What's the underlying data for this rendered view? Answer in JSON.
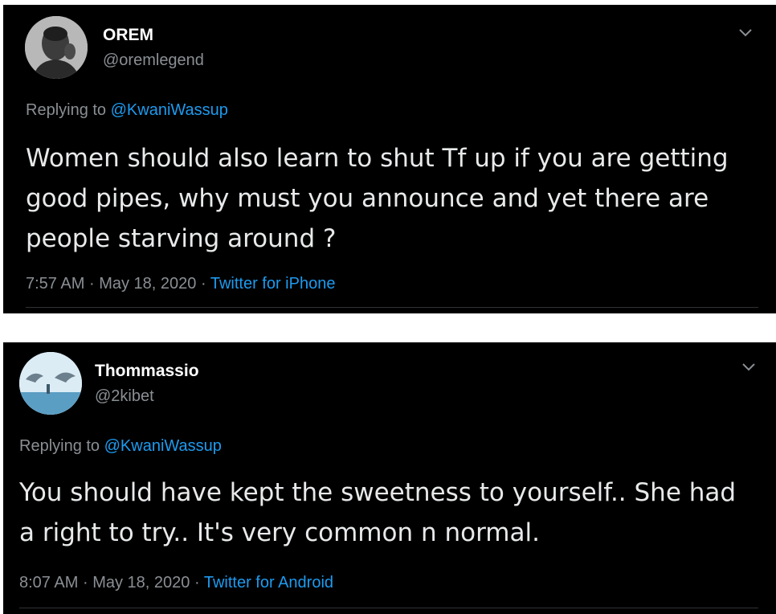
{
  "tweets": [
    {
      "display_name": "OREM",
      "handle": "@oremlegend",
      "replying_prefix": "Replying to",
      "replying_to": "@KwaniWassup",
      "text": "Women should also learn to shut Tf up if you are getting good pipes, why must you announce and yet there are people starving around ?",
      "time": "7:57 AM",
      "date": "May 18, 2020",
      "source": "Twitter for iPhone",
      "separator": "·",
      "menu_icon": "chevron-down-icon"
    },
    {
      "display_name": "Thommassio",
      "handle": "@2kibet",
      "replying_prefix": "Replying to",
      "replying_to": "@KwaniWassup",
      "text": "You should have kept the sweetness to yourself.. She had a right to try.. It's very common n normal.",
      "time": "8:07 AM",
      "date": "May 18, 2020",
      "source": "Twitter for Android",
      "separator": "·",
      "menu_icon": "chevron-down-icon"
    }
  ],
  "colors": {
    "background": "#000000",
    "text": "#e7e9ea",
    "secondary": "#8a8f94",
    "link": "#1d9bf0"
  }
}
